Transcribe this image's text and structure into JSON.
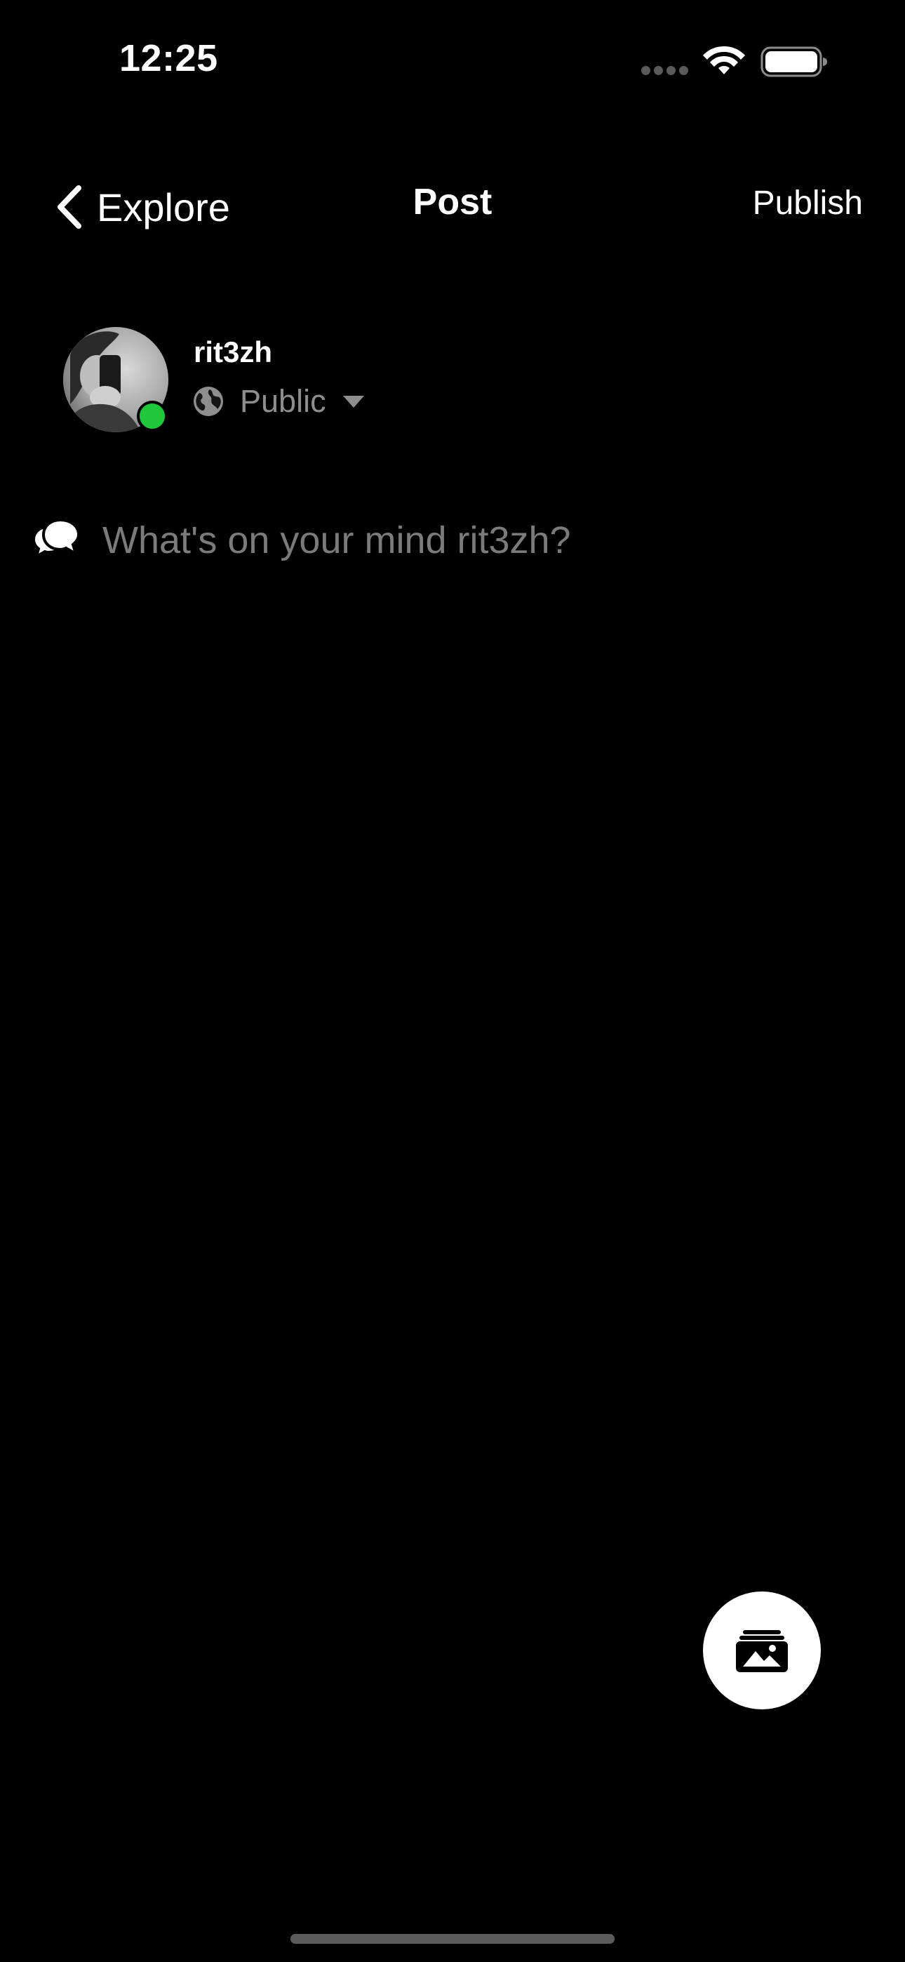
{
  "status_bar": {
    "time": "12:25",
    "icons": [
      "cellular-signal-icon",
      "wifi-icon",
      "battery-icon"
    ]
  },
  "nav": {
    "back_label": "Explore",
    "back_icon": "chevron-left-icon",
    "title": "Post",
    "publish_label": "Publish"
  },
  "author": {
    "username": "rit3zh",
    "online": true,
    "online_color": "#1ec83a",
    "audience": {
      "icon": "globe-icon",
      "label": "Public",
      "dropdown_icon": "caret-down-icon"
    }
  },
  "composer": {
    "icon": "speech-bubbles-icon",
    "value": "",
    "placeholder": "What's on your mind rit3zh?"
  },
  "media_button": {
    "icon": "photo-album-icon"
  },
  "colors": {
    "background": "#000000",
    "text": "#ffffff",
    "muted_text": "#8e8e8e",
    "placeholder": "#7b7b7b",
    "fab_background": "#ffffff"
  }
}
